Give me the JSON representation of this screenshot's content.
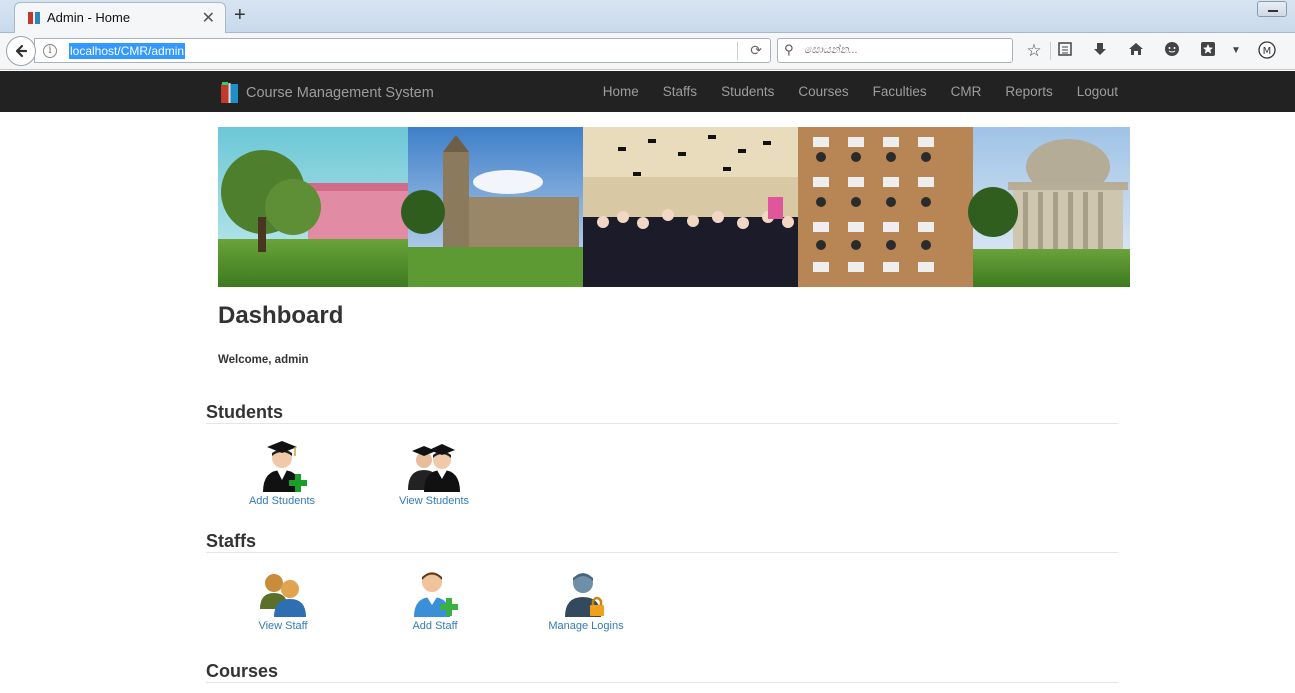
{
  "browser": {
    "tab_title": "Admin - Home",
    "url": "localhost/CMR/admin",
    "search_placeholder": "සොයන්න...",
    "toolbar_icons": [
      "bookmark-star-icon",
      "reading-list-icon",
      "download-icon",
      "home-icon",
      "chat-icon",
      "addon-icon",
      "menu-dropdown-icon",
      "profile-icon"
    ]
  },
  "site": {
    "brand": "Course Management System",
    "nav": [
      "Home",
      "Staffs",
      "Students",
      "Courses",
      "Faculties",
      "CMR",
      "Reports",
      "Logout"
    ]
  },
  "dashboard": {
    "title": "Dashboard",
    "welcome": "Welcome, admin"
  },
  "sections": {
    "students": {
      "title": "Students",
      "tiles": [
        {
          "label": "Add Students",
          "icon": "add-student-icon"
        },
        {
          "label": "View Students",
          "icon": "view-students-icon"
        }
      ]
    },
    "staffs": {
      "title": "Staffs",
      "tiles": [
        {
          "label": "View Staff",
          "icon": "view-staff-icon"
        },
        {
          "label": "Add Staff",
          "icon": "add-staff-icon"
        },
        {
          "label": "Manage Logins",
          "icon": "manage-logins-icon"
        }
      ]
    },
    "courses": {
      "title": "Courses"
    }
  },
  "colors": {
    "navbar_bg": "#222222",
    "nav_text": "#9d9d9d",
    "link": "#337ab7",
    "url_highlight": "#3399ff"
  }
}
